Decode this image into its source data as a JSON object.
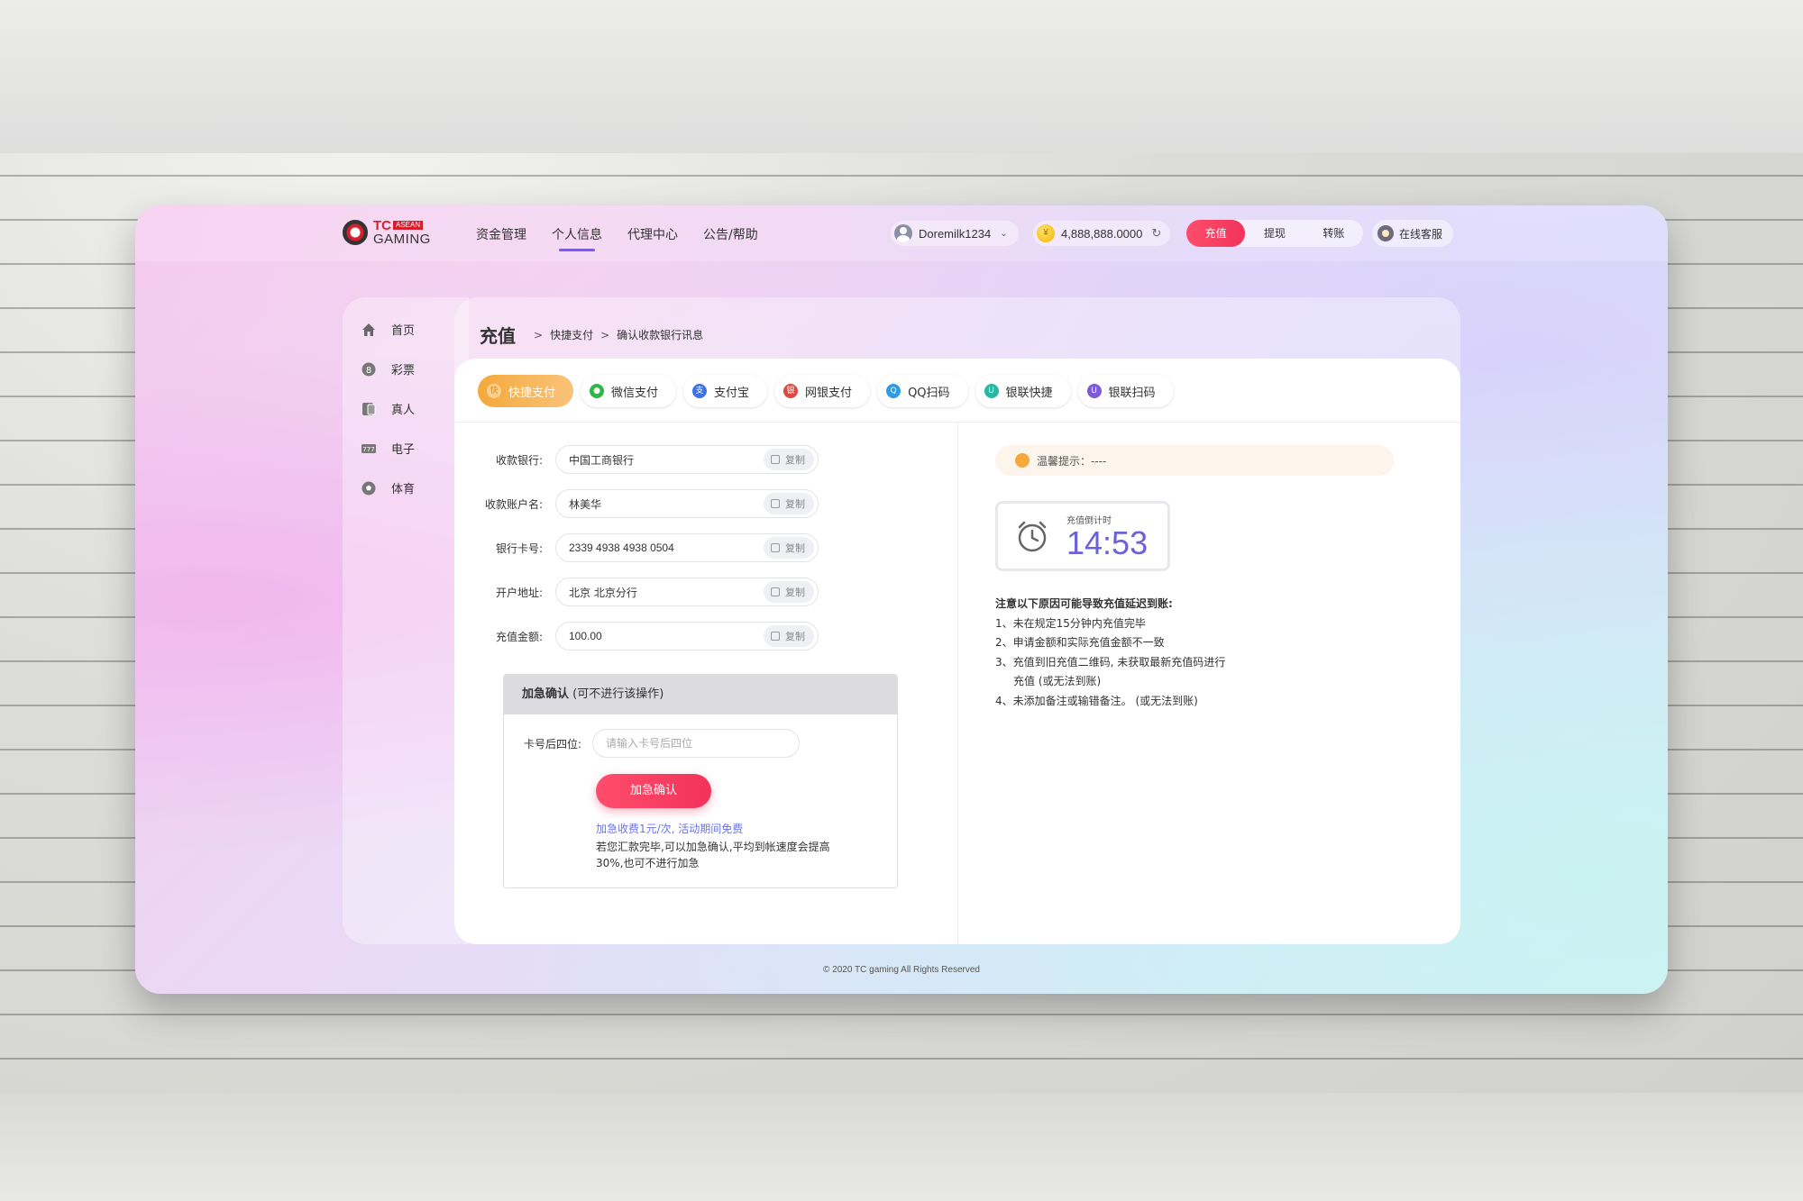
{
  "header": {
    "logo": {
      "tc": "TC",
      "asean": "ASEAN",
      "gaming": "GAMING"
    },
    "nav": [
      "资金管理",
      "个人信息",
      "代理中心",
      "公告/帮助"
    ],
    "nav_active": "个人信息",
    "username": "Doremilk1234",
    "balance": "4,888,888.0000",
    "actions": {
      "deposit": "充值",
      "withdraw": "提现",
      "transfer": "转账"
    },
    "service": "在线客服"
  },
  "sidebar": {
    "items": [
      {
        "label": "首页",
        "icon": "home-icon"
      },
      {
        "label": "彩票",
        "icon": "lottery-icon"
      },
      {
        "label": "真人",
        "icon": "live-card-icon"
      },
      {
        "label": "电子",
        "icon": "slot-icon"
      },
      {
        "label": "体育",
        "icon": "soccer-icon"
      }
    ]
  },
  "main": {
    "title": "充值",
    "breadcrumb": [
      "快捷支付",
      "确认收款银行讯息"
    ],
    "tabs": [
      {
        "label": "快捷支付",
        "color": "#f4a93a"
      },
      {
        "label": "微信支付",
        "color": "#2fb84a"
      },
      {
        "label": "支付宝",
        "color": "#3b73e6"
      },
      {
        "label": "网银支付",
        "color": "#e0473f"
      },
      {
        "label": "QQ扫码",
        "color": "#2e9be8"
      },
      {
        "label": "银联快捷",
        "color": "#2bb6a3"
      },
      {
        "label": "银联扫码",
        "color": "#7d5bd6"
      }
    ],
    "active_tab": "快捷支付",
    "fields": [
      {
        "label": "收款银行:",
        "value": "中国工商银行",
        "copy": "复制"
      },
      {
        "label": "收款账户名:",
        "value": "林美华",
        "copy": "复制"
      },
      {
        "label": "银行卡号:",
        "value": "2339 4938 4938 0504",
        "copy": "复制"
      },
      {
        "label": "开户地址:",
        "value": "北京 北京分行",
        "copy": "复制"
      },
      {
        "label": "充值金额:",
        "value": "100.00",
        "copy": "复制"
      }
    ],
    "urgent": {
      "title": "加急确认",
      "title_note": "(可不进行该操作)",
      "card_label": "卡号后四位:",
      "card_placeholder": "请输入卡号后四位",
      "button": "加急确认",
      "fee": "加急收费1元/次, 活动期间免费",
      "note": "若您汇款完毕,可以加急确认,平均到帐速度会提高30%,也可不进行加急"
    },
    "tip": "温馨提示：----",
    "timer": {
      "label": "充值倒计时",
      "value": "14:53"
    },
    "notes": {
      "heading": "注意以下原因可能导致充值延迟到账:",
      "items": [
        "1、未在规定15分钟内充值完毕",
        "2、申请金额和实际充值金额不一致",
        "3、充值到旧充值二维码, 未获取最新充值码进行",
        "充值 (或无法到账)",
        "4、未添加备注或输错备注。 (或无法到账)"
      ]
    }
  },
  "footer": "© 2020 TC gaming All Rights Reserved",
  "colors": {
    "accent": "#7b5fd6",
    "primary_button": "#f2335a",
    "active_tab": "#f4a93a",
    "timer": "#6b61d8",
    "fee_link": "#6b74e8"
  }
}
